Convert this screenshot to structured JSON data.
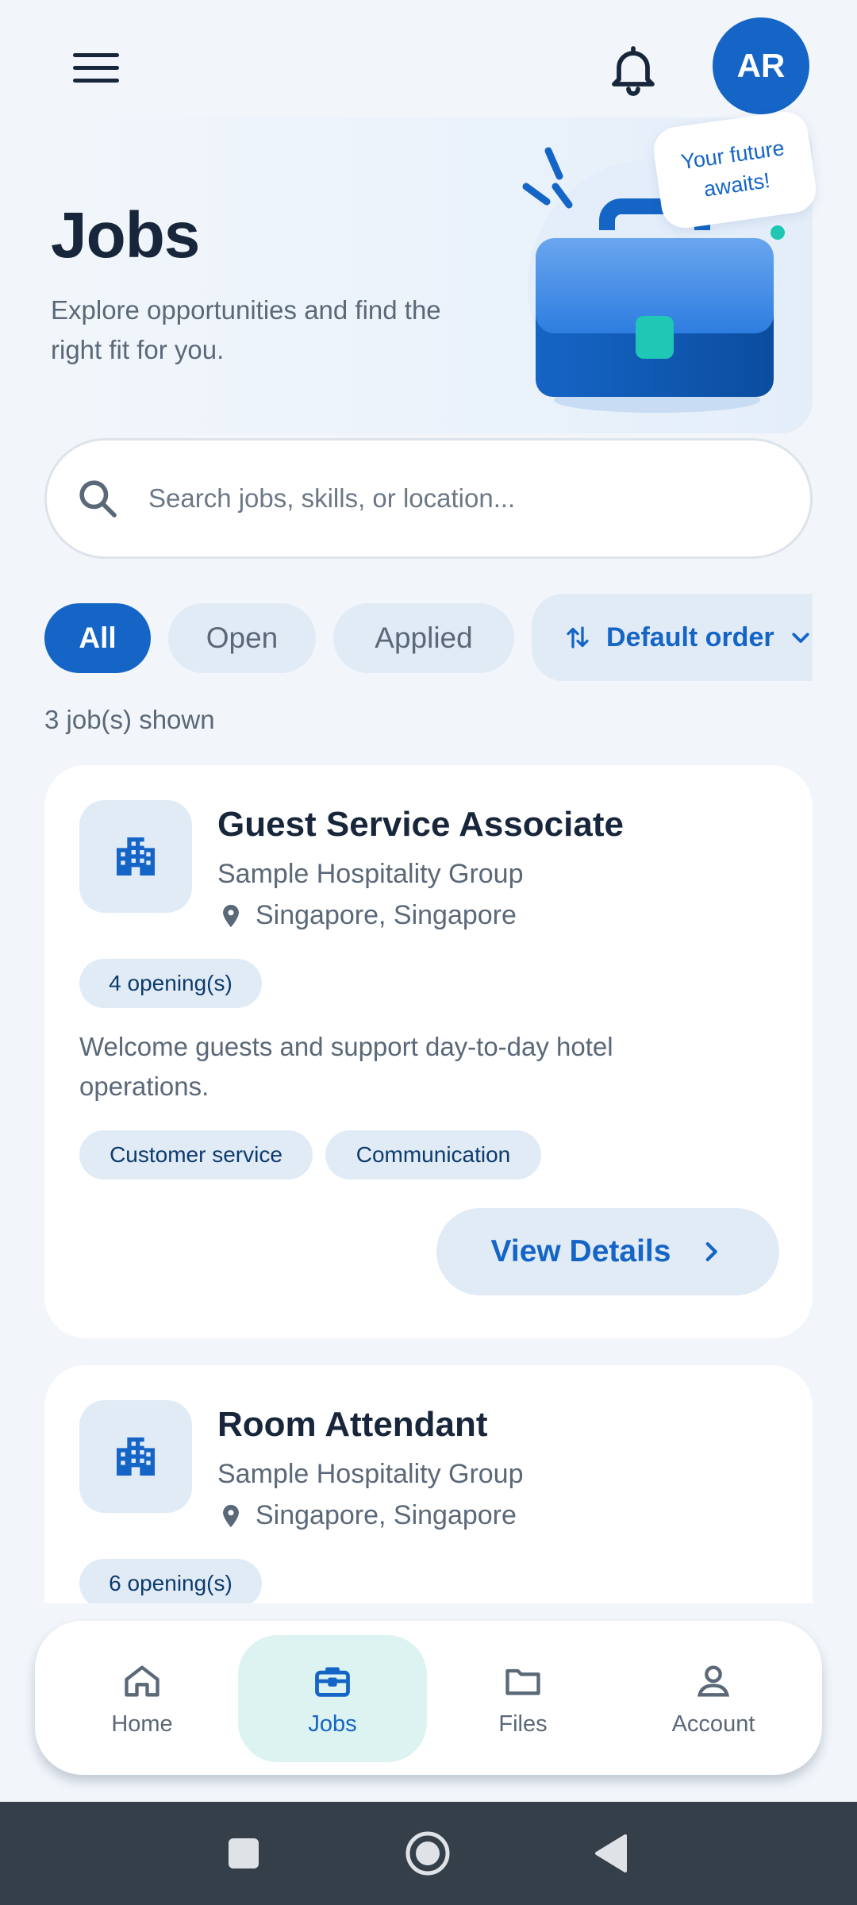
{
  "header": {
    "menu_icon": "hamburger-menu-icon",
    "notification_icon": "bell-icon",
    "avatar_initials": "AR"
  },
  "hero": {
    "title": "Jobs",
    "subtitle": "Explore opportunities and find the right fit for you.",
    "bubble_text": "Your future awaits!",
    "illustration": "briefcase-illustration"
  },
  "search": {
    "placeholder": "Search jobs, skills, or location..."
  },
  "filters": {
    "chips": [
      "All",
      "Open",
      "Applied"
    ],
    "selected": "All",
    "sort_label": "Default order"
  },
  "result_count": "3 job(s) shown",
  "jobs": [
    {
      "title": "Guest Service Associate",
      "company": "Sample Hospitality Group",
      "location": "Singapore, Singapore",
      "openings": "4 opening(s)",
      "description": "Welcome guests and support day-to-day hotel operations.",
      "tags": [
        "Customer service",
        "Communication"
      ],
      "action": "View Details"
    },
    {
      "title": "Room Attendant",
      "company": "Sample Hospitality Group",
      "location": "Singapore, Singapore",
      "openings": "6 opening(s)"
    }
  ],
  "bottom_nav": {
    "items": [
      "Home",
      "Jobs",
      "Files",
      "Account"
    ],
    "active": "Jobs"
  },
  "colors": {
    "primary": "#1565c6",
    "background": "#f2f6fb",
    "chip_bg": "#e1ebf6",
    "active_nav_bg": "#dcf3f1",
    "teal_accent": "#1ec8b5"
  }
}
